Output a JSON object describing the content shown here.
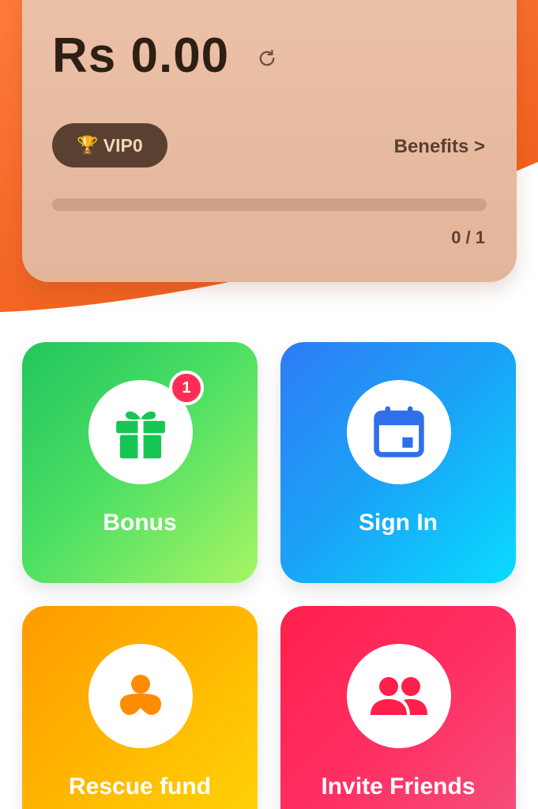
{
  "balance": {
    "amount": "Rs 0.00",
    "refresh_icon": "refresh-icon"
  },
  "vip": {
    "trophy_icon": "🏆",
    "level": "VIP0",
    "benefits_label": "Benefits >",
    "progress_current": 0,
    "progress_total": 1,
    "progress_text": "0 / 1"
  },
  "tiles": {
    "bonus": {
      "label": "Bonus",
      "icon": "gift-icon",
      "badge": "1",
      "color": "#22c55e"
    },
    "signin": {
      "label": "Sign In",
      "icon": "calendar-icon",
      "color": "#2f7bf5"
    },
    "rescue": {
      "label": "Rescue fund",
      "icon": "rescue-person-icon",
      "color": "#ff9a00"
    },
    "invite": {
      "label": "Invite Friends",
      "icon": "friends-icon",
      "color": "#ff1f4b"
    }
  },
  "colors": {
    "brand_orange": "#f26522",
    "card_bg": "#e3b59b",
    "vip_badge_bg": "#5a4030"
  }
}
